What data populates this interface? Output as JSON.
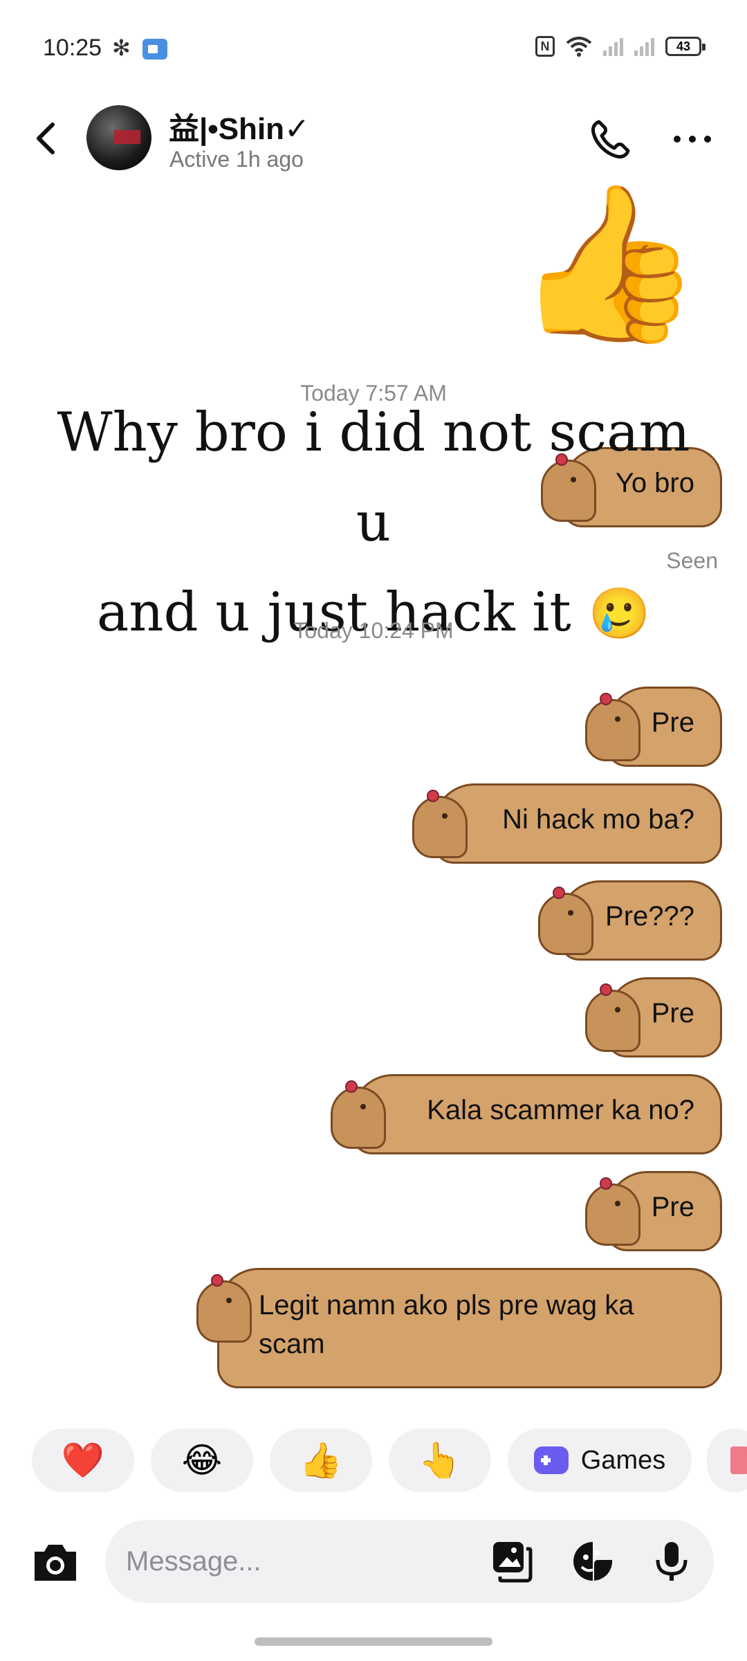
{
  "status_bar": {
    "time": "10:25",
    "nfc": "N",
    "battery": "43",
    "icons": [
      "fan-icon",
      "screen-record-icon",
      "nfc-icon",
      "wifi-icon",
      "signal-icon",
      "battery-icon"
    ]
  },
  "header": {
    "contact_name": "益|•Shin✓",
    "contact_status": "Active 1h ago",
    "icons": [
      "back-icon",
      "avatar",
      "phone-icon",
      "more-icon"
    ]
  },
  "thread": {
    "thumbs_sticker": "👍",
    "timestamp_1": "Today 7:57 AM",
    "overlay_caption_line1": "Why bro i did not scam u",
    "overlay_caption_line2": "and u just hack it",
    "overlay_caption_emoji": "🥲",
    "bubble_1": "Yo bro",
    "seen": "Seen",
    "timestamp_2": "Today 10:24 PM",
    "bubbles": [
      "Pre",
      "Ni hack mo ba?",
      "Pre???",
      "Pre",
      "Kala scammer ka no?",
      "Pre",
      "Legit namn ako pls pre wag ka scam"
    ]
  },
  "quick_reactions": {
    "heart": "❤️",
    "laugh": "😂",
    "thumbs": "👍",
    "point": "👆",
    "games_label": "Games"
  },
  "composer": {
    "placeholder": "Message...",
    "value": "",
    "icons": [
      "camera-icon",
      "gallery-icon",
      "sticker-icon",
      "mic-icon"
    ]
  },
  "colors": {
    "bubble_fill": "#d4a26b",
    "bubble_outline": "#7a4b22",
    "chip_bg": "#f1f1f3",
    "games_icon": "#6b5cf0"
  }
}
